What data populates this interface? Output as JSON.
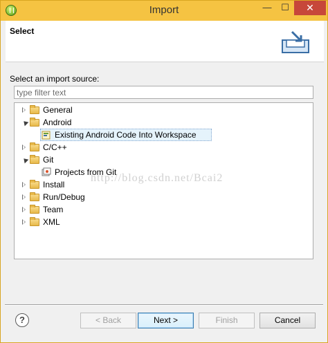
{
  "window": {
    "title": "Import",
    "min_glyph": "—",
    "max_glyph": "☐",
    "close_glyph": "✕"
  },
  "header": {
    "title": "Select"
  },
  "main": {
    "source_label": "Select an import source:",
    "filter_placeholder": "type filter text",
    "tree": [
      {
        "label": "General",
        "expanded": false
      },
      {
        "label": "Android",
        "expanded": true
      },
      {
        "label": "Existing Android Code Into Workspace",
        "child": true,
        "selected": true
      },
      {
        "label": "C/C++",
        "expanded": false
      },
      {
        "label": "Git",
        "expanded": true
      },
      {
        "label": "Projects from Git",
        "child": true
      },
      {
        "label": "Install",
        "expanded": false
      },
      {
        "label": "Run/Debug",
        "expanded": false
      },
      {
        "label": "Team",
        "expanded": false
      },
      {
        "label": "XML",
        "expanded": false
      }
    ],
    "watermark": "http://blog.csdn.net/Bcai2"
  },
  "footer": {
    "help_glyph": "?",
    "back_label": "< Back",
    "next_label": "Next >",
    "finish_label": "Finish",
    "cancel_label": "Cancel"
  },
  "colors": {
    "titlebar": "#f5c342",
    "close_button": "#c7473a",
    "selection": "#e5f3fb"
  }
}
